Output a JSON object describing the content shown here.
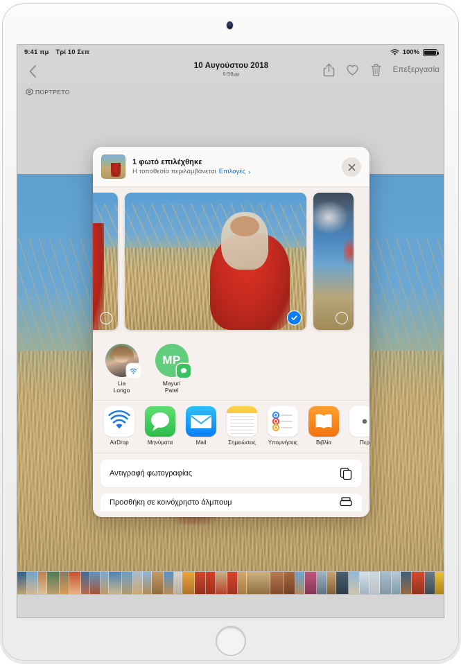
{
  "status_bar": {
    "time": "9:41 πμ",
    "date": "Τρί 10 Σεπ",
    "wifi_icon": "wifi-icon",
    "battery_percent": "100%",
    "battery_icon": "battery-full-icon"
  },
  "nav_bar": {
    "back_icon": "chevron-left-icon",
    "title": "10 Αυγούστου 2018",
    "subtitle": "6:58μμ",
    "share_icon": "share-icon",
    "favorite_icon": "heart-icon",
    "delete_icon": "trash-icon",
    "edit_label": "Επεξεργασία"
  },
  "photo_view": {
    "portrait_badge_icon": "portrait-cube-icon",
    "portrait_badge_label": "ΠΟΡΤΡΕΤΟ"
  },
  "share_sheet": {
    "header": {
      "thumbnail_name": "selected-photo-thumbnail",
      "title": "1 φωτό επιλέχθηκε",
      "subtitle": "Η τοποθεσία περιλαμβάνεται",
      "options_link": "Επιλογές",
      "chevron": "›",
      "close_icon": "close-icon"
    },
    "carousel": [
      {
        "name": "photo-previous",
        "selected": false
      },
      {
        "name": "photo-current",
        "selected": true
      },
      {
        "name": "photo-next",
        "selected": false
      }
    ],
    "contacts": [
      {
        "name": "Lia\nLongo",
        "line1": "Lia",
        "line2": "Longo",
        "type": "photo",
        "badge": "airdrop-badge-icon"
      },
      {
        "name": "Mayuri\nPatel",
        "line1": "Mayuri",
        "line2": "Patel",
        "type": "initials",
        "initials": "MP",
        "badge": "messages-badge-icon"
      }
    ],
    "apps": [
      {
        "label": "AirDrop",
        "icon": "airdrop-icon"
      },
      {
        "label": "Μηνύματα",
        "icon": "messages-icon"
      },
      {
        "label": "Mail",
        "icon": "mail-icon"
      },
      {
        "label": "Σημειώσεις",
        "icon": "notes-icon"
      },
      {
        "label": "Υπομνήσεις",
        "icon": "reminders-icon"
      },
      {
        "label": "Βιβλία",
        "icon": "books-icon"
      },
      {
        "label": "Περ",
        "icon": "more-icon"
      }
    ],
    "actions": [
      {
        "label": "Αντιγραφή φωτογραφίας",
        "icon": "copy-icon"
      },
      {
        "label": "Προσθήκη σε κοινόχρηστο άλμπουμ",
        "icon": "shared-album-icon"
      }
    ]
  },
  "colors": {
    "accent_blue": "#0a72ec",
    "selection_blue": "#0a7cf6",
    "messages_green": "#3ac162",
    "avatar_green": "#62cc7d",
    "books_orange": "#f2730d",
    "sheet_bg": "#f6f1ee"
  }
}
